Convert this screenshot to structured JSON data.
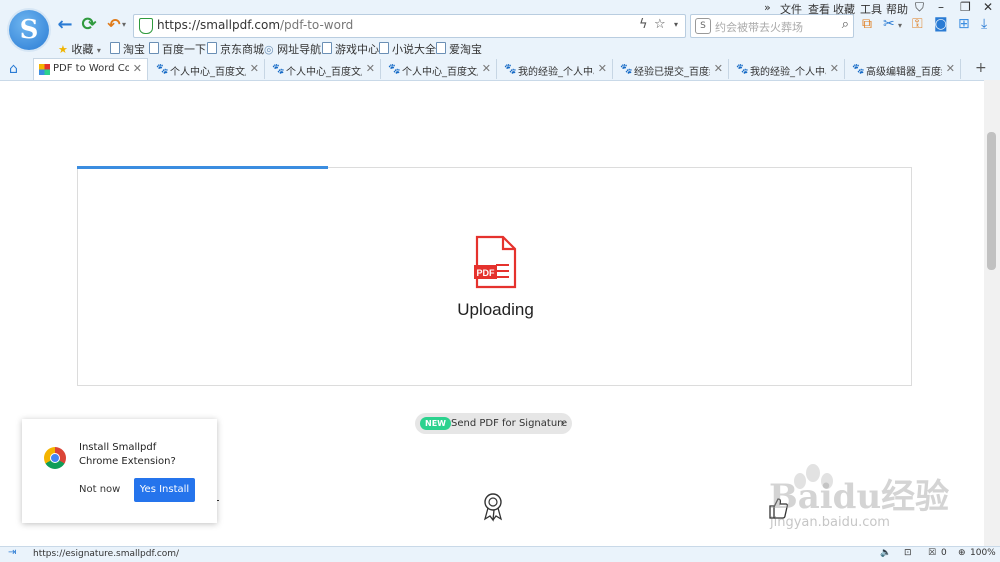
{
  "browser": {
    "logo_letter": "S",
    "menu": [
      "文件",
      "查看",
      "收藏",
      "工具",
      "帮助"
    ],
    "menu_chevron": "»",
    "address": {
      "host": "https://smallpdf.com",
      "path": "/pdf-to-word"
    },
    "search_placeholder": "约会被带去火葬场",
    "search_engine_label": "S",
    "favorites": [
      "收藏",
      "淘宝",
      "百度一下",
      "京东商城",
      "网址导航",
      "游戏中心",
      "小说大全",
      "爱淘宝"
    ],
    "tabs": [
      {
        "title": "PDF to Word Con"
      },
      {
        "title": "个人中心_百度文库"
      },
      {
        "title": "个人中心_百度文库"
      },
      {
        "title": "个人中心_百度文库"
      },
      {
        "title": "我的经验_个人中心"
      },
      {
        "title": "经验已提交_百度经"
      },
      {
        "title": "我的经验_个人中心"
      },
      {
        "title": "高级编辑器_百度经"
      }
    ],
    "new_tab": "+",
    "status_url": "https://esignature.smallpdf.com/",
    "status_count": "0",
    "zoom": "100%"
  },
  "page": {
    "upload_status": "Uploading",
    "upload_progress_pct": 30,
    "pdf_icon_label": "PDF",
    "promo": {
      "badge": "NEW",
      "text": "Send PDF for Signature",
      "chevron": "›"
    },
    "extension_popup": {
      "line1": "Install Smallpdf",
      "line2": "Chrome Extension?",
      "not_now": "Not now",
      "yes_install": "Yes Install"
    }
  },
  "watermark": {
    "brand": "Baidu经验",
    "url": "jingyan.baidu.com"
  },
  "colors": {
    "accent": "#3b8de0",
    "pdf_red": "#e5322d",
    "new_badge": "#2bd28e",
    "install_button": "#2574ec"
  }
}
